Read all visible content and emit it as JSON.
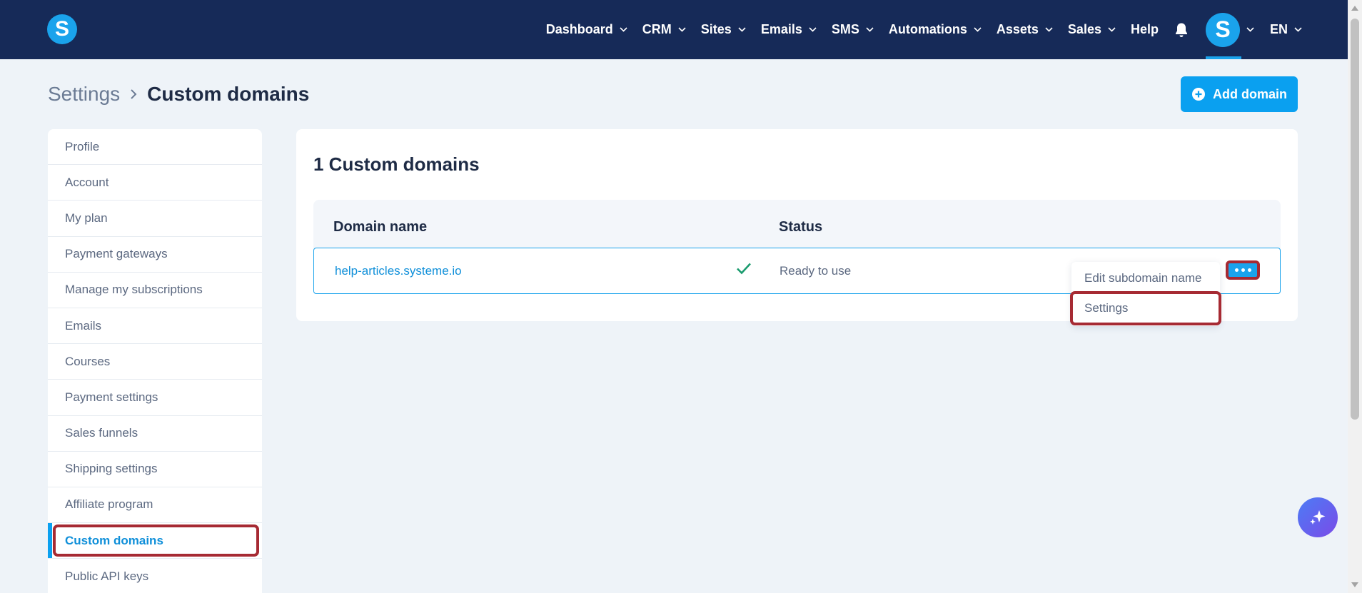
{
  "app": {
    "logo_letter": "S",
    "brand_color": "#1aa3ec",
    "nav_bg": "#162a58"
  },
  "nav": {
    "items": [
      {
        "label": "Dashboard",
        "dropdown": true
      },
      {
        "label": "CRM",
        "dropdown": true
      },
      {
        "label": "Sites",
        "dropdown": true
      },
      {
        "label": "Emails",
        "dropdown": true
      },
      {
        "label": "SMS",
        "dropdown": true
      },
      {
        "label": "Automations",
        "dropdown": true
      },
      {
        "label": "Assets",
        "dropdown": true
      },
      {
        "label": "Sales",
        "dropdown": true
      },
      {
        "label": "Help",
        "dropdown": false
      }
    ],
    "avatar_letter": "S",
    "language": "EN"
  },
  "page": {
    "breadcrumb_root": "Settings",
    "breadcrumb_current": "Custom domains",
    "add_domain_label": "Add domain"
  },
  "sidebar": {
    "items": [
      {
        "label": "Profile"
      },
      {
        "label": "Account"
      },
      {
        "label": "My plan"
      },
      {
        "label": "Payment gateways"
      },
      {
        "label": "Manage my subscriptions"
      },
      {
        "label": "Emails"
      },
      {
        "label": "Courses"
      },
      {
        "label": "Payment settings"
      },
      {
        "label": "Sales funnels"
      },
      {
        "label": "Shipping settings"
      },
      {
        "label": "Affiliate program"
      },
      {
        "label": "Custom domains",
        "active": true
      },
      {
        "label": "Public API keys"
      }
    ]
  },
  "main": {
    "card_title": "1 Custom domains",
    "columns": [
      "Domain name",
      "Status"
    ],
    "rows": [
      {
        "domain": "help-articles.systeme.io",
        "status": "Ready to use",
        "status_icon": "check-icon"
      }
    ]
  },
  "dropdown": {
    "items": [
      "Edit subdomain name",
      "Settings"
    ]
  },
  "icons": {
    "notifications": "bell-icon",
    "more": "ellipsis-icon",
    "add": "plus-circle-icon",
    "ai": "sparkle-icon"
  },
  "colors": {
    "accent": "#0aa0f0",
    "highlight": "#a62a33",
    "success": "#1a9b6e"
  }
}
